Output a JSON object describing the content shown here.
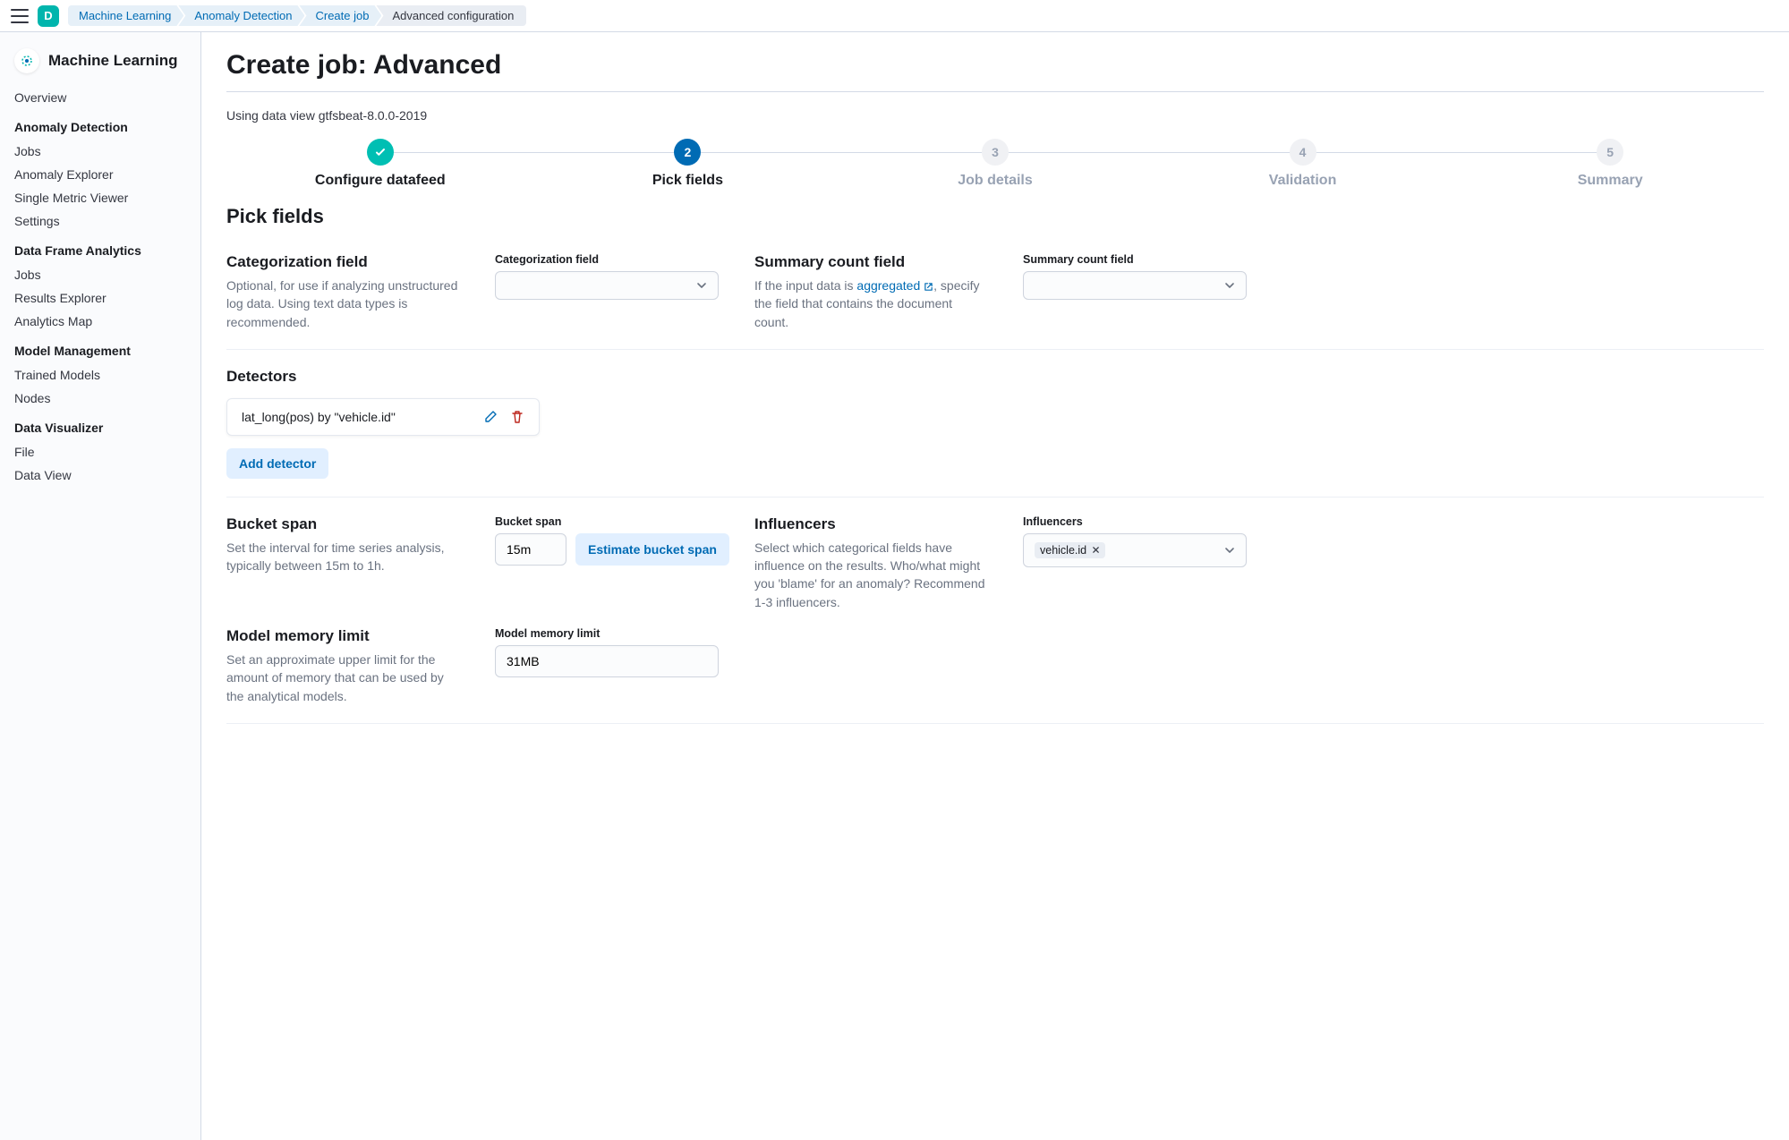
{
  "header": {
    "avatar_letter": "D",
    "breadcrumbs": [
      "Machine Learning",
      "Anomaly Detection",
      "Create job",
      "Advanced configuration"
    ]
  },
  "sidebar": {
    "title": "Machine Learning",
    "top_item": "Overview",
    "groups": [
      {
        "title": "Anomaly Detection",
        "items": [
          "Jobs",
          "Anomaly Explorer",
          "Single Metric Viewer",
          "Settings"
        ]
      },
      {
        "title": "Data Frame Analytics",
        "items": [
          "Jobs",
          "Results Explorer",
          "Analytics Map"
        ]
      },
      {
        "title": "Model Management",
        "items": [
          "Trained Models",
          "Nodes"
        ]
      },
      {
        "title": "Data Visualizer",
        "items": [
          "File",
          "Data View"
        ]
      }
    ]
  },
  "page": {
    "title": "Create job: Advanced",
    "subtitle": "Using data view gtfsbeat-8.0.0-2019"
  },
  "steps": [
    {
      "label": "Configure datafeed",
      "state": "done"
    },
    {
      "label": "Pick fields",
      "num": "2",
      "state": "active"
    },
    {
      "label": "Job details",
      "num": "3",
      "state": "upcoming"
    },
    {
      "label": "Validation",
      "num": "4",
      "state": "upcoming"
    },
    {
      "label": "Summary",
      "num": "5",
      "state": "upcoming"
    }
  ],
  "section_heading": "Pick fields",
  "categorization": {
    "title": "Categorization field",
    "desc": "Optional, for use if analyzing unstructured log data. Using text data types is recommended.",
    "field_label": "Categorization field",
    "value": ""
  },
  "summary_count": {
    "title": "Summary count field",
    "desc_prefix": "If the input data is ",
    "desc_link": "aggregated",
    "desc_suffix": ", specify the field that contains the document count.",
    "field_label": "Summary count field",
    "value": ""
  },
  "detectors": {
    "title": "Detectors",
    "items": [
      "lat_long(pos) by \"vehicle.id\""
    ],
    "add_label": "Add detector"
  },
  "bucket_span": {
    "title": "Bucket span",
    "desc": "Set the interval for time series analysis, typically between 15m to 1h.",
    "field_label": "Bucket span",
    "value": "15m",
    "estimate_label": "Estimate bucket span"
  },
  "influencers": {
    "title": "Influencers",
    "desc": "Select which categorical fields have influence on the results. Who/what might you 'blame' for an anomaly? Recommend 1-3 influencers.",
    "field_label": "Influencers",
    "chips": [
      "vehicle.id"
    ]
  },
  "model_memory": {
    "title": "Model memory limit",
    "desc": "Set an approximate upper limit for the amount of memory that can be used by the analytical models.",
    "field_label": "Model memory limit",
    "value": "31MB"
  }
}
